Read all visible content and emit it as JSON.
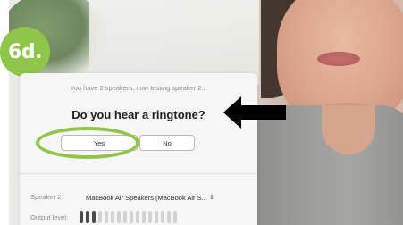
{
  "badge": {
    "label": "6d."
  },
  "dialog": {
    "status": "You have 2 speakers, now testing speaker 2...",
    "question": "Do you hear a ringtone?",
    "yes_label": "Yes",
    "no_label": "No",
    "speaker_label": "Speaker 2:",
    "speaker_value": "MacBook Air Speakers (MacBook Air S...",
    "output_label": "Output level:",
    "output_level": {
      "active_bars": 3,
      "total_bars": 16
    }
  },
  "colors": {
    "accent_green": "#8fc549",
    "arrow": "#000000",
    "dialog_bg": "#f6f6f6"
  },
  "icons": {
    "select_chevron": "chevron-up-down-icon",
    "pointer_arrow": "left-arrow-icon"
  }
}
